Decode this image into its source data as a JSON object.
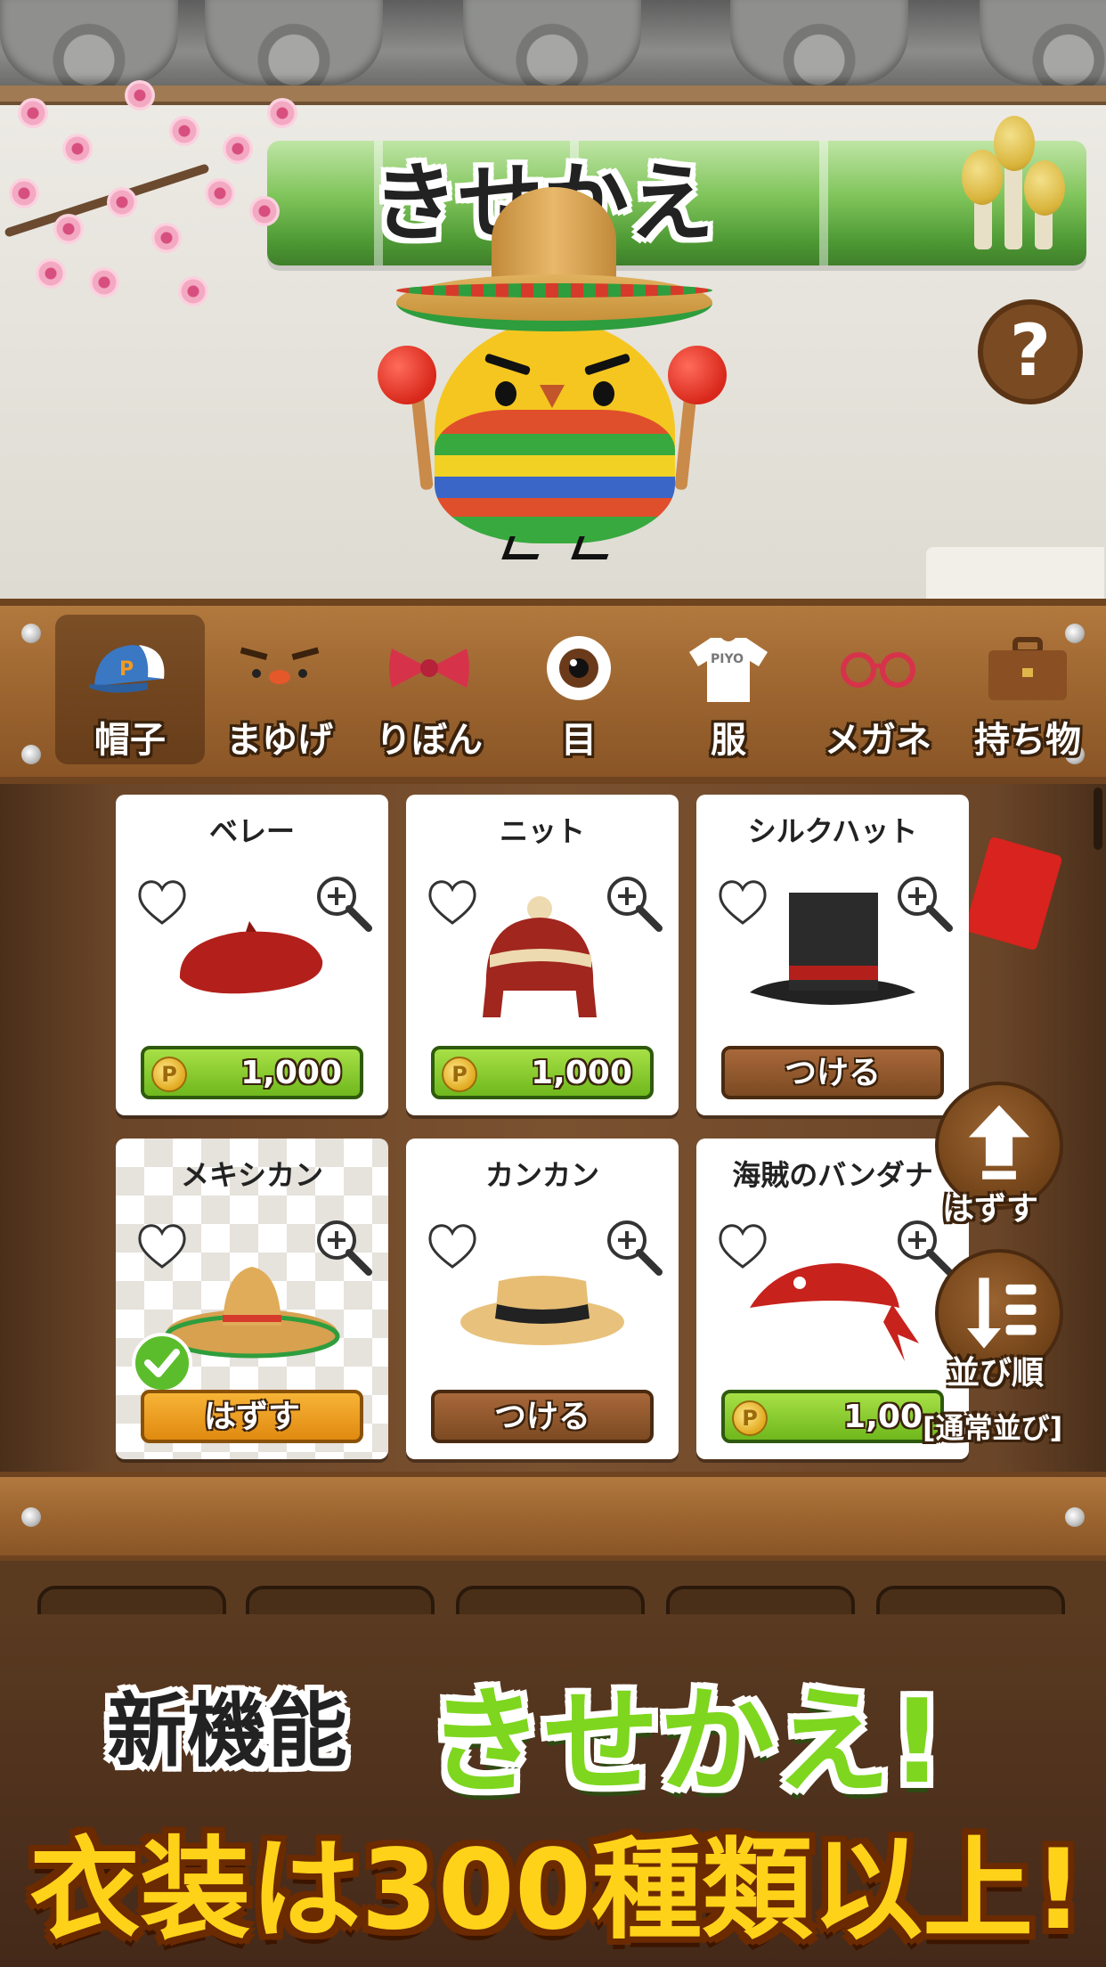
{
  "header": {
    "title": "きせかえ",
    "help_label": "?"
  },
  "categories": [
    {
      "label": "帽子",
      "icon": "cap-icon",
      "active": true
    },
    {
      "label": "まゆげ",
      "icon": "eyebrows-icon",
      "active": false
    },
    {
      "label": "りぼん",
      "icon": "ribbon-icon",
      "active": false
    },
    {
      "label": "目",
      "icon": "eye-icon",
      "active": false
    },
    {
      "label": "服",
      "icon": "shirt-icon",
      "shirt_text": "PIYO",
      "active": false
    },
    {
      "label": "メガネ",
      "icon": "glasses-icon",
      "active": false
    },
    {
      "label": "持ち物",
      "icon": "briefcase-icon",
      "active": false
    }
  ],
  "items": [
    {
      "name": "ベレー",
      "button": "1,000",
      "button_type": "price",
      "icon": "beret-icon"
    },
    {
      "name": "ニット",
      "button": "1,000",
      "button_type": "price",
      "icon": "knit-cap-icon"
    },
    {
      "name": "シルクハット",
      "button": "つける",
      "button_type": "wear",
      "icon": "top-hat-icon"
    },
    {
      "name": "メキシカン",
      "button": "はずす",
      "button_type": "remove",
      "icon": "sombrero-icon",
      "equipped": true
    },
    {
      "name": "カンカン",
      "button": "つける",
      "button_type": "wear",
      "icon": "boater-hat-icon"
    },
    {
      "name": "海賊のバンダナ",
      "button": "1,00",
      "button_type": "price",
      "icon": "bandana-icon"
    }
  ],
  "coin_symbol": "P",
  "side": {
    "remove_label": "はずす",
    "sort_label": "並び順",
    "sort_mode": "[通常並び]"
  },
  "promo": {
    "line1_prefix": "新機能",
    "line1_main": "きせかえ!",
    "line2": "衣装は300種類以上!"
  },
  "colors": {
    "wood": "#9c6530",
    "price_green": "#6fb81d",
    "remove_orange": "#e08a10",
    "promo_yellow": "#ffd21a",
    "promo_green": "#7ed61e"
  }
}
